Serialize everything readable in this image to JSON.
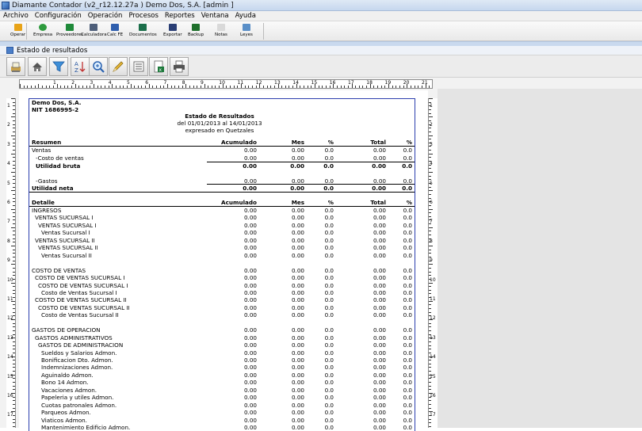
{
  "window": {
    "title": "Diamante Contador (v2_r12.12.27a )  Demo Dos, S.A.  [admin ]"
  },
  "menu": [
    "Archivo",
    "Configuración",
    "Operación",
    "Procesos",
    "Reportes",
    "Ventana",
    "Ayuda"
  ],
  "toolbar": [
    {
      "label": "Operar",
      "icon": "lightning-icon",
      "color": "#e8a317"
    },
    {
      "label": "Empresa",
      "icon": "refresh-icon",
      "color": "#2e9b3e"
    },
    {
      "label": "Proveedores",
      "icon": "people-icon",
      "color": "#1f8a3a"
    },
    {
      "label": "Calculadora",
      "icon": "calculator-icon",
      "color": "#4e5f7a"
    },
    {
      "label": "Calc FE",
      "icon": "formula-icon",
      "color": "#2f5fae"
    },
    {
      "label": "Documentos",
      "icon": "document-icon",
      "color": "#1b6e4a"
    },
    {
      "label": "Exportar",
      "icon": "export-icon",
      "color": "#2a3e75"
    },
    {
      "label": "Backup",
      "icon": "save-icon",
      "color": "#1e6f2b"
    },
    {
      "label": "Notas",
      "icon": "notes-icon",
      "color": "#d9d9d9"
    },
    {
      "label": "Leyes",
      "icon": "law-icon",
      "color": "#5a8fc8"
    }
  ],
  "document": {
    "title": "Estado de resultados"
  },
  "report_toolbar": [
    "print-settings-icon",
    "home-icon",
    "filter-icon",
    "sort-az-icon",
    "zoom-icon",
    "edit-icon",
    "list-icon",
    "excel-export-icon",
    "printer-icon"
  ],
  "ruler": {
    "h_labels": [
      "1",
      "2",
      "3",
      "4",
      "5",
      "6",
      "7",
      "8",
      "9",
      "10",
      "11",
      "12",
      "13",
      "14",
      "15",
      "16",
      "17",
      "18",
      "19",
      "20",
      "21"
    ],
    "v_labels": [
      "1",
      "2",
      "3",
      "4",
      "5",
      "6",
      "7",
      "8",
      "9",
      "10",
      "11",
      "12",
      "13",
      "14",
      "15",
      "16",
      "17"
    ]
  },
  "report": {
    "company": "Demo Dos, S.A.",
    "nit": "NIT 1686995-2",
    "title": "Estado de Resultados",
    "period": "del 01/01/2013 al 14/01/2013",
    "currency": "expresado en Quetzales",
    "summary_header": {
      "label": "Resumen",
      "acum": "Acumulado",
      "mes": "Mes",
      "pct1": "%",
      "total": "Total",
      "pct2": "%"
    },
    "summary_rows": [
      {
        "label": "Ventas",
        "indent": 0,
        "bold": false,
        "acum": "0.00",
        "mes": "0.00",
        "pct1": "0.0",
        "total": "0.00",
        "pct2": "0.0"
      },
      {
        "label": "-Costo de ventas",
        "indent": 1,
        "bold": false,
        "acum": "0.00",
        "mes": "0.00",
        "pct1": "0.0",
        "total": "0.00",
        "pct2": "0.0"
      },
      {
        "label": "Utilidad bruta",
        "indent": 1,
        "bold": true,
        "acum": "0.00",
        "mes": "0.00",
        "pct1": "0.0",
        "total": "0.00",
        "pct2": "0.0"
      },
      {
        "label": "",
        "indent": 0,
        "bold": false,
        "acum": "",
        "mes": "",
        "pct1": "",
        "total": "",
        "pct2": ""
      },
      {
        "label": "-Gastos",
        "indent": 1,
        "bold": false,
        "acum": "0.00",
        "mes": "0.00",
        "pct1": "0.0",
        "total": "0.00",
        "pct2": "0.0"
      },
      {
        "label": "Utilidad neta",
        "indent": 0,
        "bold": true,
        "acum": "0.00",
        "mes": "0.00",
        "pct1": "0.0",
        "total": "0.00",
        "pct2": "0.0"
      }
    ],
    "detail_header": {
      "label": "Detalle",
      "acum": "Acumulado",
      "mes": "Mes",
      "pct1": "%",
      "total": "Total",
      "pct2": "%"
    },
    "detail_rows": [
      {
        "label": "INGRESOS",
        "indent": 0,
        "acum": "0.00",
        "mes": "0.00",
        "pct1": "0.0",
        "total": "0.00",
        "pct2": "0.0"
      },
      {
        "label": "VENTAS SUCURSAL I",
        "indent": 1,
        "acum": "0.00",
        "mes": "0.00",
        "pct1": "0.0",
        "total": "0.00",
        "pct2": "0.0"
      },
      {
        "label": "VENTAS SUCURSAL I",
        "indent": 2,
        "acum": "0.00",
        "mes": "0.00",
        "pct1": "0.0",
        "total": "0.00",
        "pct2": "0.0"
      },
      {
        "label": "Ventas Sucursal I",
        "indent": 3,
        "acum": "0.00",
        "mes": "0.00",
        "pct1": "0.0",
        "total": "0.00",
        "pct2": "0.0"
      },
      {
        "label": "VENTAS SUCURSAL II",
        "indent": 1,
        "acum": "0.00",
        "mes": "0.00",
        "pct1": "0.0",
        "total": "0.00",
        "pct2": "0.0"
      },
      {
        "label": "VENTAS SUCURSAL II",
        "indent": 2,
        "acum": "0.00",
        "mes": "0.00",
        "pct1": "0.0",
        "total": "0.00",
        "pct2": "0.0"
      },
      {
        "label": "Ventas Sucursal II",
        "indent": 3,
        "acum": "0.00",
        "mes": "0.00",
        "pct1": "0.0",
        "total": "0.00",
        "pct2": "0.0"
      },
      {
        "label": "",
        "indent": 0,
        "acum": "",
        "mes": "",
        "pct1": "",
        "total": "",
        "pct2": ""
      },
      {
        "label": "COSTO DE VENTAS",
        "indent": 0,
        "acum": "0.00",
        "mes": "0.00",
        "pct1": "0.0",
        "total": "0.00",
        "pct2": "0.0"
      },
      {
        "label": "COSTO DE VENTAS SUCURSAL I",
        "indent": 1,
        "acum": "0.00",
        "mes": "0.00",
        "pct1": "0.0",
        "total": "0.00",
        "pct2": "0.0"
      },
      {
        "label": "COSTO DE VENTAS SUCURSAL I",
        "indent": 2,
        "acum": "0.00",
        "mes": "0.00",
        "pct1": "0.0",
        "total": "0.00",
        "pct2": "0.0"
      },
      {
        "label": "Costo de Ventas Sucursal I",
        "indent": 3,
        "acum": "0.00",
        "mes": "0.00",
        "pct1": "0.0",
        "total": "0.00",
        "pct2": "0.0"
      },
      {
        "label": "COSTO DE VENTAS SUCURSAL II",
        "indent": 1,
        "acum": "0.00",
        "mes": "0.00",
        "pct1": "0.0",
        "total": "0.00",
        "pct2": "0.0"
      },
      {
        "label": "COSTO DE VENTAS SUCURSAL II",
        "indent": 2,
        "acum": "0.00",
        "mes": "0.00",
        "pct1": "0.0",
        "total": "0.00",
        "pct2": "0.0"
      },
      {
        "label": "Costo de Ventas Sucursal II",
        "indent": 3,
        "acum": "0.00",
        "mes": "0.00",
        "pct1": "0.0",
        "total": "0.00",
        "pct2": "0.0"
      },
      {
        "label": "",
        "indent": 0,
        "acum": "",
        "mes": "",
        "pct1": "",
        "total": "",
        "pct2": ""
      },
      {
        "label": "GASTOS DE OPERACION",
        "indent": 0,
        "acum": "0.00",
        "mes": "0.00",
        "pct1": "0.0",
        "total": "0.00",
        "pct2": "0.0"
      },
      {
        "label": "GASTOS ADMINISTRATIVOS",
        "indent": 1,
        "acum": "0.00",
        "mes": "0.00",
        "pct1": "0.0",
        "total": "0.00",
        "pct2": "0.0"
      },
      {
        "label": "GASTOS DE ADMINISTRACION",
        "indent": 2,
        "acum": "0.00",
        "mes": "0.00",
        "pct1": "0.0",
        "total": "0.00",
        "pct2": "0.0"
      },
      {
        "label": "Sueldos y Salarios Admon.",
        "indent": 3,
        "acum": "0.00",
        "mes": "0.00",
        "pct1": "0.0",
        "total": "0.00",
        "pct2": "0.0"
      },
      {
        "label": "Bonificacion Dto.  Admon.",
        "indent": 3,
        "acum": "0.00",
        "mes": "0.00",
        "pct1": "0.0",
        "total": "0.00",
        "pct2": "0.0"
      },
      {
        "label": "Indemnizaciones  Admon.",
        "indent": 3,
        "acum": "0.00",
        "mes": "0.00",
        "pct1": "0.0",
        "total": "0.00",
        "pct2": "0.0"
      },
      {
        "label": "Aguinaldo  Admon.",
        "indent": 3,
        "acum": "0.00",
        "mes": "0.00",
        "pct1": "0.0",
        "total": "0.00",
        "pct2": "0.0"
      },
      {
        "label": "Bono 14 Admon.",
        "indent": 3,
        "acum": "0.00",
        "mes": "0.00",
        "pct1": "0.0",
        "total": "0.00",
        "pct2": "0.0"
      },
      {
        "label": "Vacaciones Admon.",
        "indent": 3,
        "acum": "0.00",
        "mes": "0.00",
        "pct1": "0.0",
        "total": "0.00",
        "pct2": "0.0"
      },
      {
        "label": "Papeleria y utiles  Admon.",
        "indent": 3,
        "acum": "0.00",
        "mes": "0.00",
        "pct1": "0.0",
        "total": "0.00",
        "pct2": "0.0"
      },
      {
        "label": "Cuotas patronales  Admon.",
        "indent": 3,
        "acum": "0.00",
        "mes": "0.00",
        "pct1": "0.0",
        "total": "0.00",
        "pct2": "0.0"
      },
      {
        "label": "Parqueos Admon.",
        "indent": 3,
        "acum": "0.00",
        "mes": "0.00",
        "pct1": "0.0",
        "total": "0.00",
        "pct2": "0.0"
      },
      {
        "label": "Viaticos Admon.",
        "indent": 3,
        "acum": "0.00",
        "mes": "0.00",
        "pct1": "0.0",
        "total": "0.00",
        "pct2": "0.0"
      },
      {
        "label": "Mantenimiento Edificio Admon.",
        "indent": 3,
        "acum": "0.00",
        "mes": "0.00",
        "pct1": "0.0",
        "total": "0.00",
        "pct2": "0.0"
      }
    ]
  }
}
